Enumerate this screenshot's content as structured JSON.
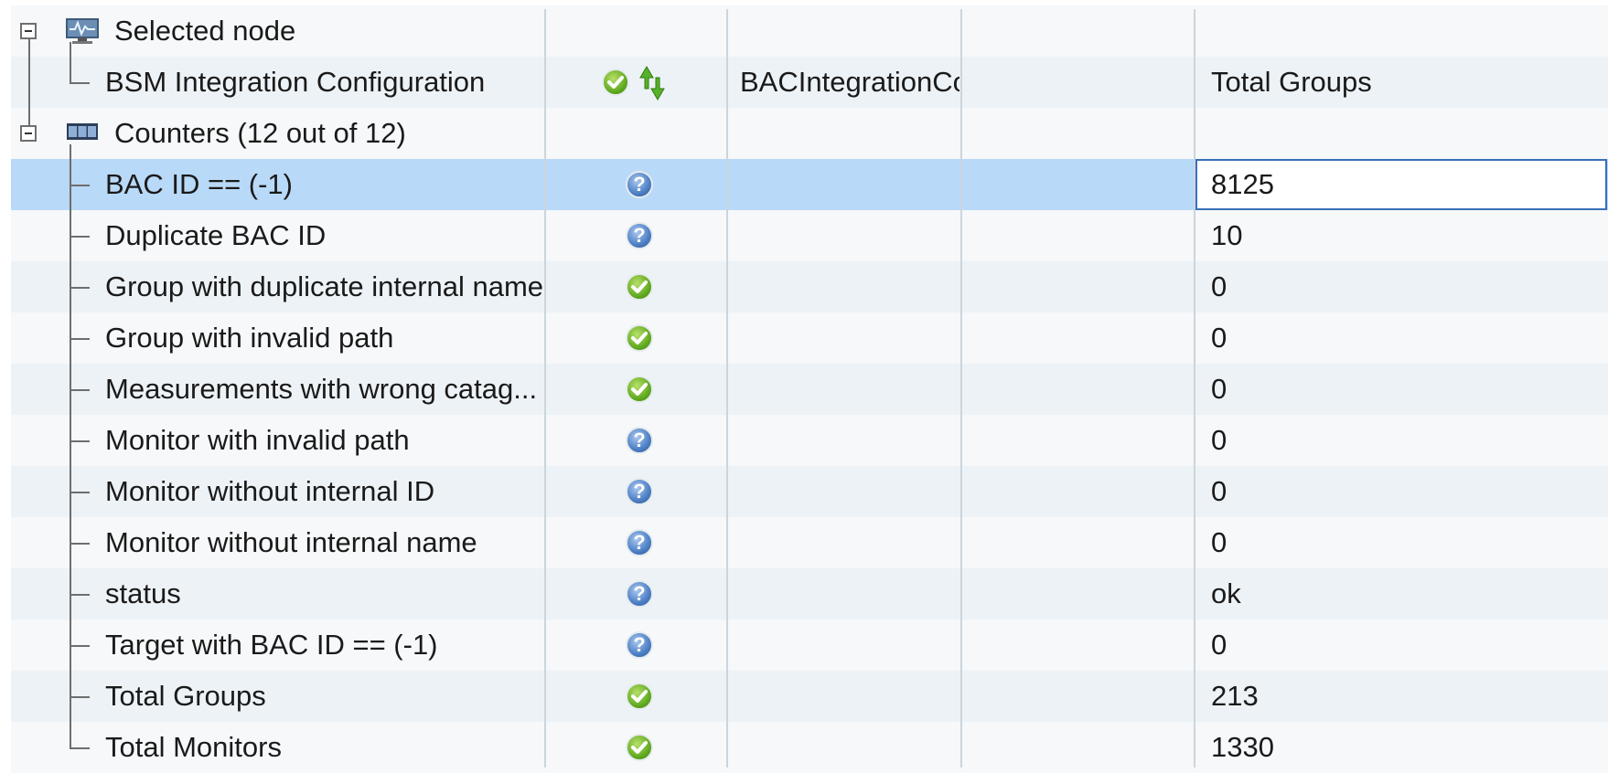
{
  "colors": {
    "ok_green": "#5da71d",
    "unknown_blue": "#4d7fc4",
    "selection": "#b9d9f8",
    "row_alt": "#edf2f6"
  },
  "selected_node": {
    "label": "Selected node",
    "icon": "monitor-icon",
    "child": {
      "label": "BSM Integration Configuration",
      "status_icons": [
        "ok-check-icon",
        "sync-arrows-icon"
      ],
      "col3": "BACIntegrationCo",
      "col5": "Total Groups"
    }
  },
  "counters": {
    "label": "Counters (12 out of 12)",
    "icon": "counter-icon",
    "items": [
      {
        "name": "BAC ID == (-1)",
        "status": "unknown",
        "value": "8125"
      },
      {
        "name": "Duplicate BAC ID",
        "status": "unknown",
        "value": "10"
      },
      {
        "name": "Group with duplicate internal name",
        "status": "ok",
        "value": "0"
      },
      {
        "name": "Group with invalid path",
        "status": "ok",
        "value": "0"
      },
      {
        "name": "Measurements with wrong catag...",
        "status": "ok",
        "value": "0"
      },
      {
        "name": "Monitor with invalid path",
        "status": "unknown",
        "value": "0"
      },
      {
        "name": "Monitor without internal ID",
        "status": "unknown",
        "value": "0"
      },
      {
        "name": "Monitor without internal name",
        "status": "unknown",
        "value": "0"
      },
      {
        "name": "status",
        "status": "unknown",
        "value": "ok"
      },
      {
        "name": "Target with BAC ID == (-1)",
        "status": "unknown",
        "value": "0"
      },
      {
        "name": "Total Groups",
        "status": "ok",
        "value": "213"
      },
      {
        "name": "Total Monitors",
        "status": "ok",
        "value": "1330"
      }
    ]
  }
}
